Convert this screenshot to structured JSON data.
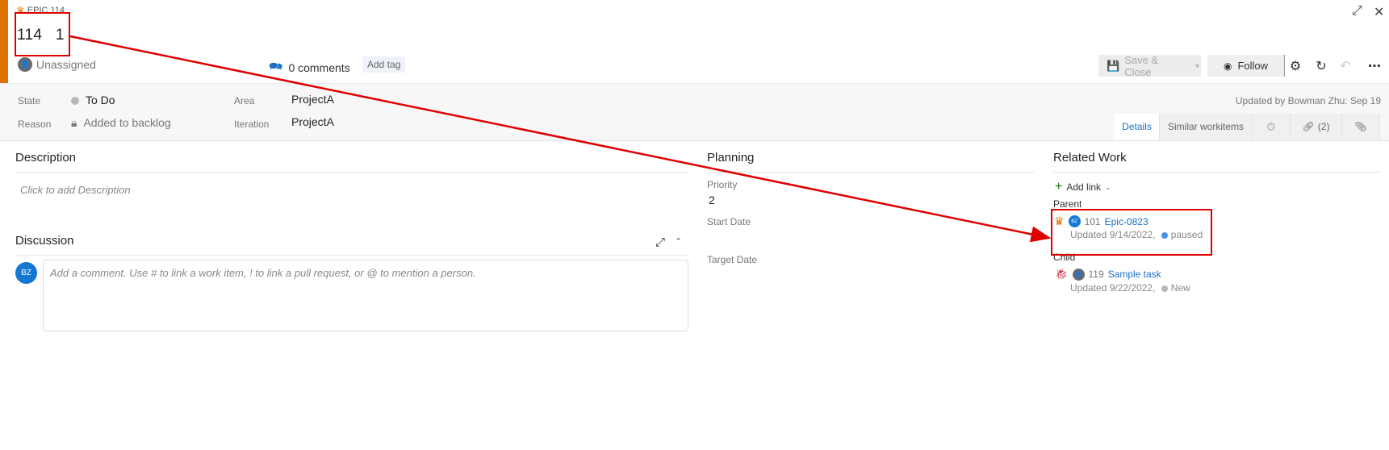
{
  "workitem": {
    "type_label": "EPIC 114",
    "type_icon": "crown-icon",
    "title": "114   1",
    "assignee": "Unassigned",
    "comments_label": "0 comments",
    "add_tag_label": "Add tag"
  },
  "toolbar": {
    "save_close_label": "Save & Close",
    "follow_label": "Follow",
    "icons": [
      "settings-icon",
      "refresh-icon",
      "undo-icon",
      "more-icon"
    ]
  },
  "window": {
    "expand_icon": "↗",
    "close_icon": "✕"
  },
  "fields": {
    "state_label": "State",
    "state_value": "To Do",
    "reason_label": "Reason",
    "reason_value": "Added to backlog",
    "area_label": "Area",
    "area_value": "ProjectA",
    "iteration_label": "Iteration",
    "iteration_value": "ProjectA"
  },
  "updated_by": "Updated by Bowman Zhu: Sep 19",
  "tabs": [
    {
      "label": "Details",
      "active": true
    },
    {
      "label": "Similar workitems"
    },
    {
      "label": "",
      "icon": "history-icon"
    },
    {
      "label": "(2)",
      "icon": "link-icon"
    },
    {
      "label": "",
      "icon": "attachment-icon"
    }
  ],
  "description": {
    "title": "Description",
    "placeholder": "Click to add Description"
  },
  "discussion": {
    "title": "Discussion",
    "avatar_initials": "BZ",
    "placeholder": "Add a comment. Use # to link a work item, ! to link a pull request, or @ to mention a person."
  },
  "planning": {
    "title": "Planning",
    "priority_label": "Priority",
    "priority_value": "2",
    "start_date_label": "Start Date",
    "start_date_value": "",
    "target_date_label": "Target Date",
    "target_date_value": ""
  },
  "related_work": {
    "title": "Related Work",
    "add_link_label": "Add link",
    "parent_label": "Parent",
    "parent": {
      "id": "101",
      "title": "Epic-0823",
      "avatar_initials": "BZ",
      "updated": "Updated 9/14/2022,",
      "state": "paused",
      "state_color": "#4a8ee8"
    },
    "child_label": "Child",
    "child": {
      "id": "119",
      "title": "Sample task",
      "updated": "Updated 9/22/2022,",
      "state": "New",
      "state_color": "#b8b8b8"
    }
  },
  "colors": {
    "accent": "#1d6fc6",
    "epic_orange": "#e07200",
    "annotation_red": "#e00000"
  }
}
